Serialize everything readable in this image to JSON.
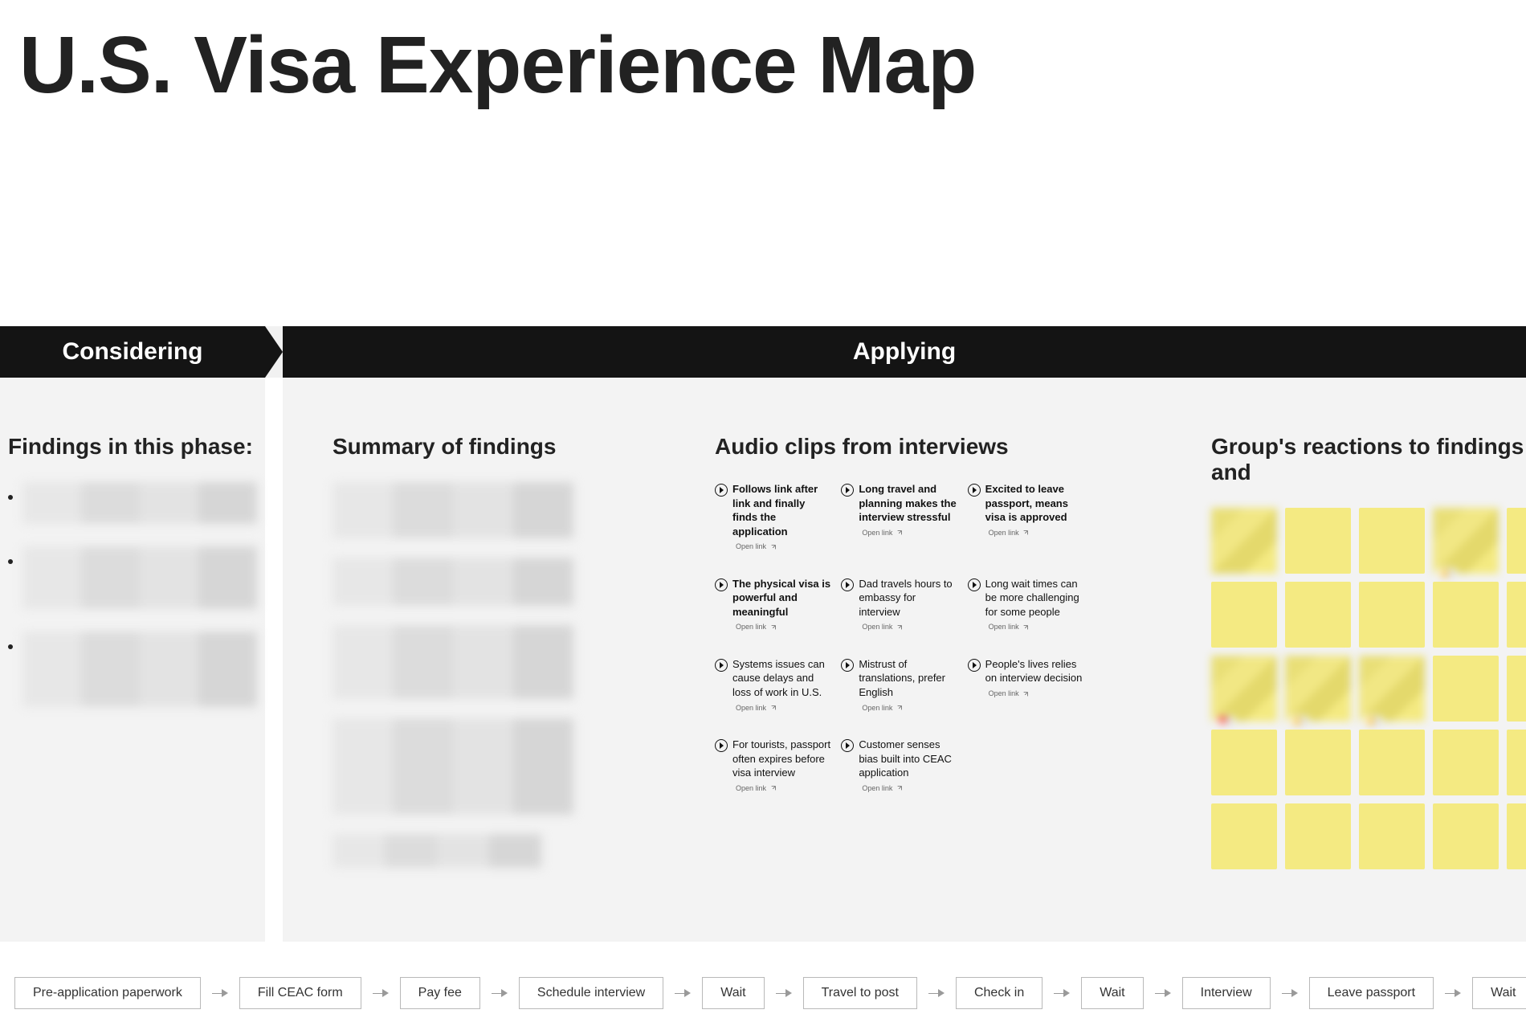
{
  "title": "U.S. Visa Experience Map",
  "phases": {
    "considering": "Considering",
    "applying": "Applying"
  },
  "columns": {
    "findings_heading": "Findings in this phase:",
    "summary_heading": "Summary of findings",
    "audio_heading": "Audio clips from interviews",
    "reactions_heading": "Group's reactions to findings and"
  },
  "open_link_label": "Open link",
  "audio_clips": [
    {
      "text": "Follows link after link and finally finds the application",
      "bold": true
    },
    {
      "text": "Long travel and planning makes the interview stressful",
      "bold": true
    },
    {
      "text": "Excited to leave passport, means visa is approved",
      "bold": true
    },
    {
      "text": "The physical visa is powerful and meaningful",
      "bold": true
    },
    {
      "text": "Dad travels hours to embassy for interview",
      "bold": false
    },
    {
      "text": "Long wait times can be more challenging for some people",
      "bold": false
    },
    {
      "text": "Systems issues can cause delays and loss of work in U.S.",
      "bold": false
    },
    {
      "text": "Mistrust of translations, prefer English",
      "bold": false
    },
    {
      "text": "People's lives relies on interview decision",
      "bold": false
    },
    {
      "text": "For tourists, passport often expires before visa interview",
      "bold": false
    },
    {
      "text": "Customer senses bias built into CEAC application",
      "bold": false
    }
  ],
  "stickies": [
    {
      "blurred": true,
      "reaction": null
    },
    {
      "blurred": false,
      "reaction": null
    },
    {
      "blurred": false,
      "reaction": null
    },
    {
      "blurred": true,
      "reaction": "👍1"
    },
    {
      "blurred": false,
      "reaction": null
    },
    {
      "blurred": false,
      "reaction": null
    },
    {
      "blurred": false,
      "reaction": null
    },
    {
      "blurred": false,
      "reaction": null
    },
    {
      "blurred": false,
      "reaction": null
    },
    {
      "blurred": false,
      "reaction": null
    },
    {
      "blurred": true,
      "reaction": "❤️1"
    },
    {
      "blurred": true,
      "reaction": "👍1"
    },
    {
      "blurred": true,
      "reaction": "👍1"
    },
    {
      "blurred": false,
      "reaction": null
    },
    {
      "blurred": false,
      "reaction": null
    },
    {
      "blurred": false,
      "reaction": null
    },
    {
      "blurred": false,
      "reaction": null
    },
    {
      "blurred": false,
      "reaction": null
    },
    {
      "blurred": false,
      "reaction": null
    },
    {
      "blurred": false,
      "reaction": null
    },
    {
      "blurred": false,
      "reaction": null
    },
    {
      "blurred": false,
      "reaction": null
    },
    {
      "blurred": false,
      "reaction": null
    },
    {
      "blurred": false,
      "reaction": null
    },
    {
      "blurred": false,
      "reaction": null
    }
  ],
  "timeline": [
    "Pre-application paperwork",
    "Fill CEAC form",
    "Pay fee",
    "Schedule interview",
    "Wait",
    "Travel to post",
    "Check in",
    "Wait",
    "Interview",
    "Leave passport",
    "Wait"
  ]
}
